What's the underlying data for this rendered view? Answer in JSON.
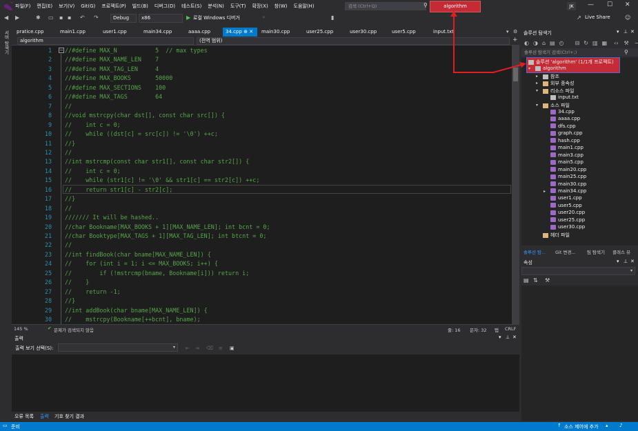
{
  "menu": [
    "파일(F)",
    "편집(E)",
    "보기(V)",
    "Git(G)",
    "프로젝트(P)",
    "빌드(B)",
    "디버그(D)",
    "테스트(S)",
    "분석(N)",
    "도구(T)",
    "확장(X)",
    "창(W)",
    "도움말(H)"
  ],
  "search": {
    "placeholder": "검색 (Ctrl+Q)"
  },
  "solution_title": "algorithm",
  "avatar": "JK",
  "toolbar": {
    "config": "Debug",
    "platform": "x86",
    "run_label": "로컬 Windows 디버거",
    "live_share": "Live Share"
  },
  "left_strip": "서버 탐색기",
  "tabs": [
    "pratice.cpp",
    "main1.cpp",
    "user1.cpp",
    "main34.cpp",
    "aaaa.cpp",
    "34.cpp",
    "main30.cpp",
    "user25.cpp",
    "user30.cpp",
    "user5.cpp",
    "input.txt"
  ],
  "navbar": {
    "project": "algorithm",
    "scope": "(전역 범위)"
  },
  "code": [
    {
      "n": "1",
      "t": "//#define MAX_N           5  // max types"
    },
    {
      "n": "2",
      "t": "//#define MAX_NAME_LEN    7"
    },
    {
      "n": "3",
      "t": "//#define MAX_TAG_LEN     4"
    },
    {
      "n": "4",
      "t": "//#define MAX_BOOKS       50000"
    },
    {
      "n": "5",
      "t": "//#define MAX_SECTIONS    100"
    },
    {
      "n": "6",
      "t": "//#define MAX_TAGS        64"
    },
    {
      "n": "7",
      "t": "//"
    },
    {
      "n": "8",
      "t": "//void mstrcpy(char dst[], const char src[]) {"
    },
    {
      "n": "9",
      "t": "//    int c = 0;"
    },
    {
      "n": "10",
      "t": "//    while ((dst[c] = src[c]) != '\\0') ++c;"
    },
    {
      "n": "11",
      "t": "//}"
    },
    {
      "n": "12",
      "t": "//"
    },
    {
      "n": "13",
      "t": "//int mstrcmp(const char str1[], const char str2[]) {"
    },
    {
      "n": "14",
      "t": "//    int c = 0;"
    },
    {
      "n": "15",
      "t": "//    while (str1[c] != '\\0' && str1[c] == str2[c]) ++c;"
    },
    {
      "n": "16",
      "t": "//    return str1[c] - str2[c];"
    },
    {
      "n": "17",
      "t": "//}"
    },
    {
      "n": "18",
      "t": "//"
    },
    {
      "n": "19",
      "t": "/////// It will be hashed.."
    },
    {
      "n": "20",
      "t": "//char Bookname[MAX_BOOKS + 1][MAX_NAME_LEN]; int bcnt = 0;"
    },
    {
      "n": "21",
      "t": "//char Booktype[MAX_TAGS + 1][MAX_TAG_LEN]; int btcnt = 0;"
    },
    {
      "n": "22",
      "t": "//"
    },
    {
      "n": "23",
      "t": "//int findBook(char bname[MAX_NAME_LEN]) {"
    },
    {
      "n": "24",
      "t": "//    for (int i = 1; i <= MAX_BOOKS; i++) {"
    },
    {
      "n": "25",
      "t": "//        if (!mstrcmp(bname, Bookname[i])) return i;"
    },
    {
      "n": "26",
      "t": "//    }"
    },
    {
      "n": "27",
      "t": "//    return -1;"
    },
    {
      "n": "28",
      "t": "//}"
    },
    {
      "n": "29",
      "t": "//int addBook(char bname[MAX_NAME_LEN]) {"
    },
    {
      "n": "30",
      "t": "//    mstrcpy(Bookname[++bcnt], bname);"
    }
  ],
  "editor_status": {
    "zoom": "145 %",
    "issues": "문제가 검색되지 않음",
    "line": "줄: 16",
    "col": "문자: 32",
    "tab": "탭",
    "eol": "CRLF"
  },
  "output": {
    "title": "출력",
    "show_from": "출력 보기 선택(S):"
  },
  "bottom_tabs": [
    "오류 목록",
    "출력",
    "기호 찾기 결과"
  ],
  "solution_explorer": {
    "title": "솔루션 탐색기",
    "search_placeholder": "솔루션 탐색기 검색(Ctrl+;)",
    "solution_label": "솔루션 'algorithm' (1/1개 프로젝트)",
    "project": "algorithm",
    "folders": [
      "참조",
      "외부 종속성",
      "리소스 파일",
      "소스 파일",
      "헤더 파일"
    ],
    "resource_files": [
      "input.txt"
    ],
    "source_files": [
      "34.cpp",
      "aaaa.cpp",
      "dfs.cpp",
      "graph.cpp",
      "hash.cpp",
      "main1.cpp",
      "main3.cpp",
      "main5.cpp",
      "main20.cpp",
      "main25.cpp",
      "main30.cpp",
      "main34.cpp",
      "user1.cpp",
      "user5.cpp",
      "user20.cpp",
      "user25.cpp",
      "user30.cpp"
    ],
    "tabs": [
      "솔루션 탐...",
      "Git 변경...",
      "팀 탐색기",
      "클래스 뷰"
    ]
  },
  "properties": {
    "title": "속성"
  },
  "status": {
    "ready": "준비",
    "source_control": "소스 제어에 추가"
  },
  "colors": {
    "accent": "#007acc",
    "highlight": "#c42b35",
    "comment": "#57a64a",
    "line_number": "#2b91af"
  }
}
